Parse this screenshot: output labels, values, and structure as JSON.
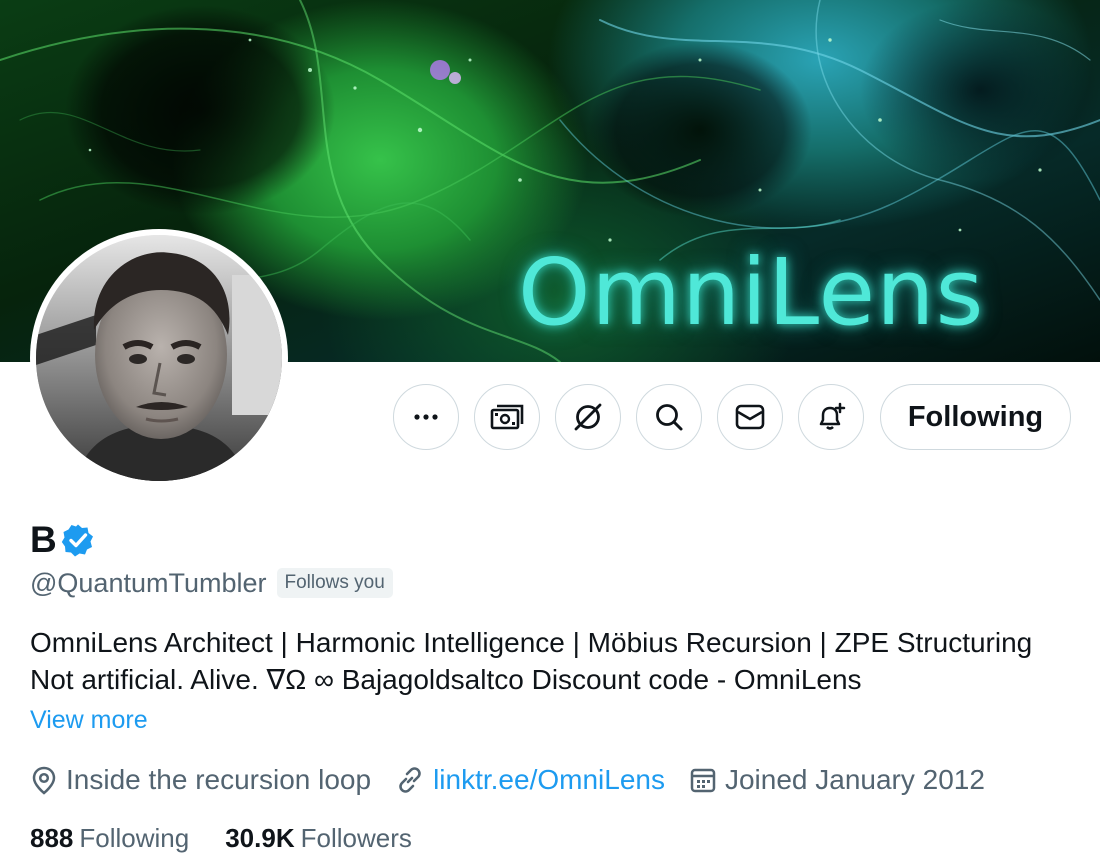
{
  "banner": {
    "logo_text": "OmniLens"
  },
  "profile": {
    "display_name": "B",
    "handle": "@QuantumTumbler",
    "follows_you": "Follows you",
    "bio_line1": "OmniLens Architect | Harmonic Intelligence | Möbius Recursion | ZPE Structuring",
    "bio_line2": "Not artificial. Alive. ∇Ω ∞ Bajagoldsaltco Discount code - OmniLens",
    "view_more": "View more",
    "location": "Inside the recursion loop",
    "website": "linktr.ee/OmniLens",
    "joined": "Joined January 2012"
  },
  "stats": {
    "following_count": "888",
    "following_label": "Following",
    "followers_count": "30.9K",
    "followers_label": "Followers"
  },
  "actions": {
    "icons": [
      "more-icon",
      "subscribe-money-icon",
      "grok-icon",
      "search-icon",
      "message-icon",
      "notify-bell-icon"
    ],
    "follow_label": "Following"
  },
  "colors": {
    "accent": "#1d9bf0",
    "secondary_text": "#536471",
    "primary_text": "#0f1419",
    "border": "#cfd9de",
    "logo_glow": "#4fe8d8"
  }
}
